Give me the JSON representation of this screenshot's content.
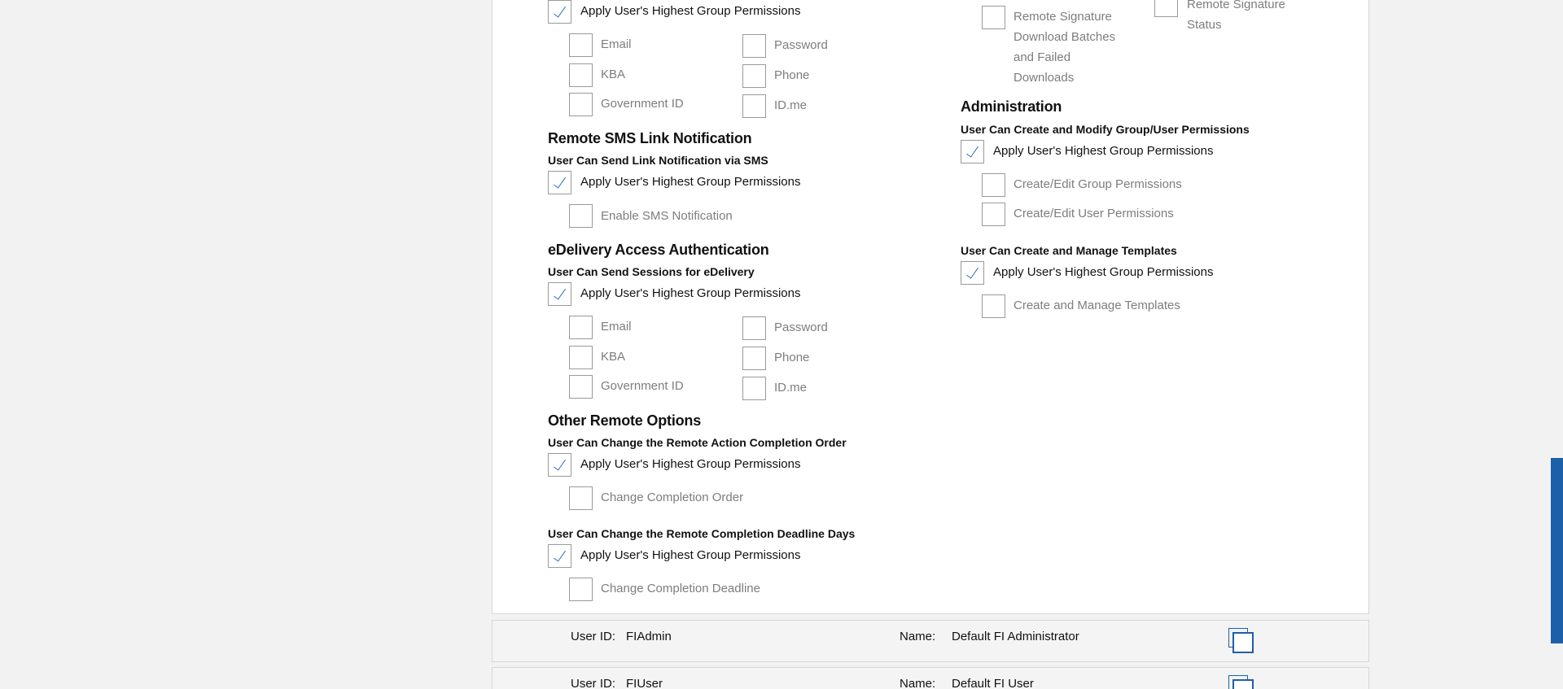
{
  "common": {
    "apply_highest": "Apply User's Highest Group Permissions"
  },
  "left": {
    "top_options": {
      "email": "Email",
      "password": "Password",
      "kba": "KBA",
      "phone": "Phone",
      "government_id": "Government ID",
      "idme": "ID.me"
    },
    "sms": {
      "title": "Remote SMS Link Notification",
      "subtitle": "User Can Send Link Notification via SMS",
      "enable": "Enable SMS Notification"
    },
    "edelivery": {
      "title": "eDelivery Access Authentication",
      "subtitle": "User Can Send Sessions for eDelivery",
      "email": "Email",
      "password": "Password",
      "kba": "KBA",
      "phone": "Phone",
      "government_id": "Government ID",
      "idme": "ID.me"
    },
    "other": {
      "title": "Other Remote Options",
      "order_subtitle": "User Can Change the Remote Action Completion Order",
      "order_option": "Change Completion Order",
      "deadline_subtitle": "User Can Change the Remote Completion Deadline Days",
      "deadline_option": "Change Completion Deadline"
    }
  },
  "right": {
    "batches": "Remote Signature Download Batches and Failed Downloads",
    "status": "Remote Signature Status",
    "admin": {
      "title": "Administration",
      "subtitle": "User Can Create and Modify Group/User Permissions",
      "group": "Create/Edit Group Permissions",
      "user": "Create/Edit User Permissions"
    },
    "templates": {
      "subtitle": "User Can Create and Manage Templates",
      "option": "Create and Manage Templates"
    }
  },
  "users": [
    {
      "id_label": "User ID:",
      "id": "FIAdmin",
      "name_label": "Name:",
      "name": "Default FI Administrator"
    },
    {
      "id_label": "User ID:",
      "id": "FIUser",
      "name_label": "Name:",
      "name": "Default FI User"
    }
  ],
  "colors": {
    "accent": "#1d5fa8",
    "check": "#2f6db5",
    "muted_text": "#7d7d7d"
  },
  "icons": {
    "copy": "copy-icon",
    "check": "check-icon"
  }
}
